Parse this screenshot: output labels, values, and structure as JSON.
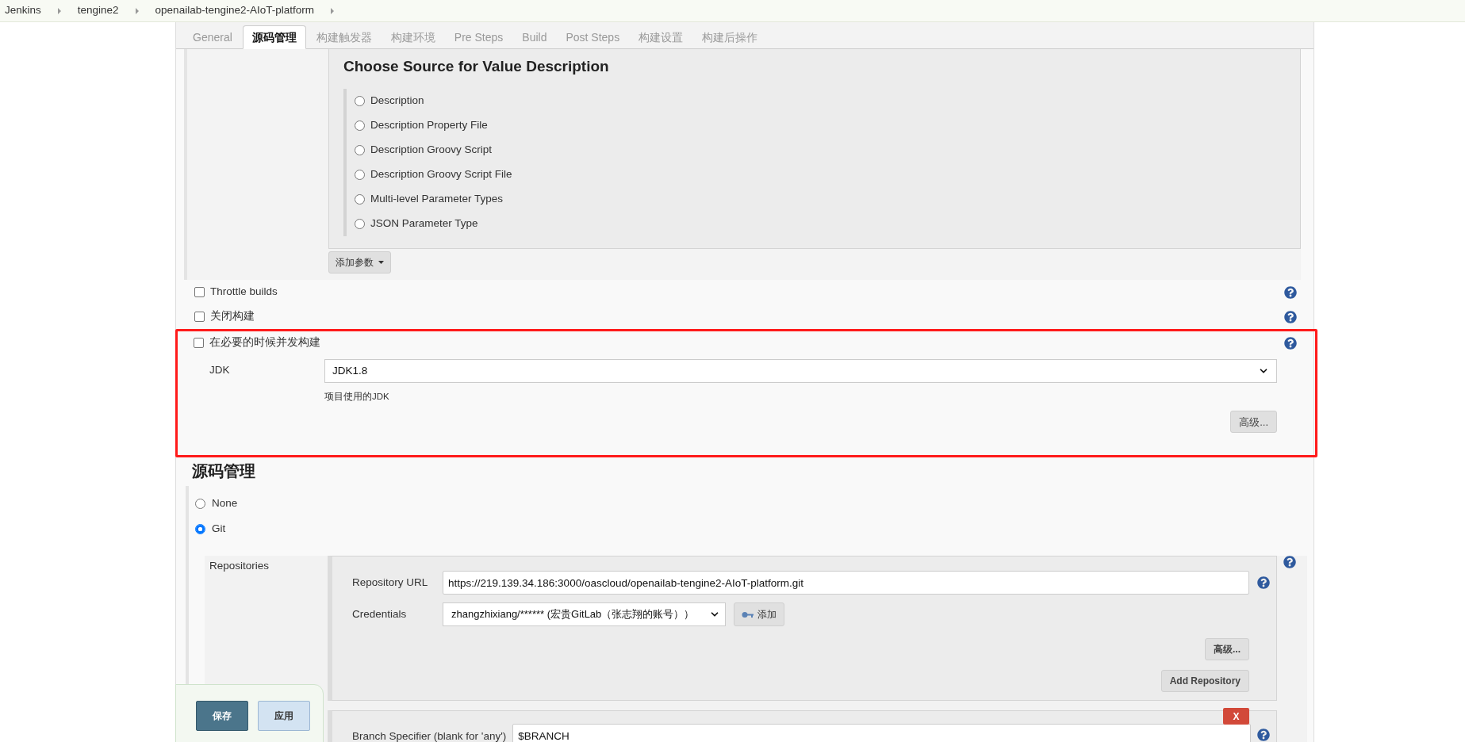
{
  "breadcrumb": [
    "Jenkins",
    "tengine2",
    "openailab-tengine2-AIoT-platform"
  ],
  "tabs": [
    {
      "label": "General",
      "selected": false
    },
    {
      "label": "源码管理",
      "selected": true
    },
    {
      "label": "构建触发器",
      "selected": false
    },
    {
      "label": "构建环境",
      "selected": false
    },
    {
      "label": "Pre Steps",
      "selected": false
    },
    {
      "label": "Build",
      "selected": false
    },
    {
      "label": "Post Steps",
      "selected": false
    },
    {
      "label": "构建设置",
      "selected": false
    },
    {
      "label": "构建后操作",
      "selected": false
    }
  ],
  "parameter_chooser": {
    "title": "Choose Source for Value Description",
    "options": [
      {
        "label": "Description",
        "selected": false
      },
      {
        "label": "Description Property File",
        "selected": false
      },
      {
        "label": "Description Groovy Script",
        "selected": false
      },
      {
        "label": "Description Groovy Script File",
        "selected": false
      },
      {
        "label": "Multi-level Parameter Types",
        "selected": false
      },
      {
        "label": "JSON Parameter Type",
        "selected": false
      }
    ],
    "add_button": "添加参数"
  },
  "options": [
    {
      "label": "Throttle builds",
      "checked": false
    },
    {
      "label": "关闭构建",
      "checked": false
    }
  ],
  "concurrent": {
    "label": "在必要的时候并发构建",
    "checked": false
  },
  "jdk": {
    "label": "JDK",
    "value": "JDK1.8",
    "hint": "项目使用的JDK",
    "advanced_button": "高级..."
  },
  "scm": {
    "heading": "源码管理",
    "options": [
      {
        "label": "None",
        "selected": false
      },
      {
        "label": "Git",
        "selected": true
      }
    ],
    "repositories": {
      "label": "Repositories",
      "url_label": "Repository URL",
      "url": "https://219.139.34.186:3000/oascloud/openailab-tengine2-AIoT-platform.git",
      "credentials_label": "Credentials",
      "credentials": "zhangzhixiang/****** (宏贵GitLab（张志翔的账号））",
      "add_credentials": "添加",
      "advanced_button": "高级...",
      "add_repository": "Add Repository"
    },
    "branches": {
      "delete_button": "X",
      "branch_label": "Branch Specifier (blank for 'any')",
      "branch_value": "$BRANCH"
    }
  },
  "footer_buttons": [
    {
      "label": "保存",
      "kind": "primary"
    },
    {
      "label": "应用",
      "kind": "secondary"
    }
  ]
}
